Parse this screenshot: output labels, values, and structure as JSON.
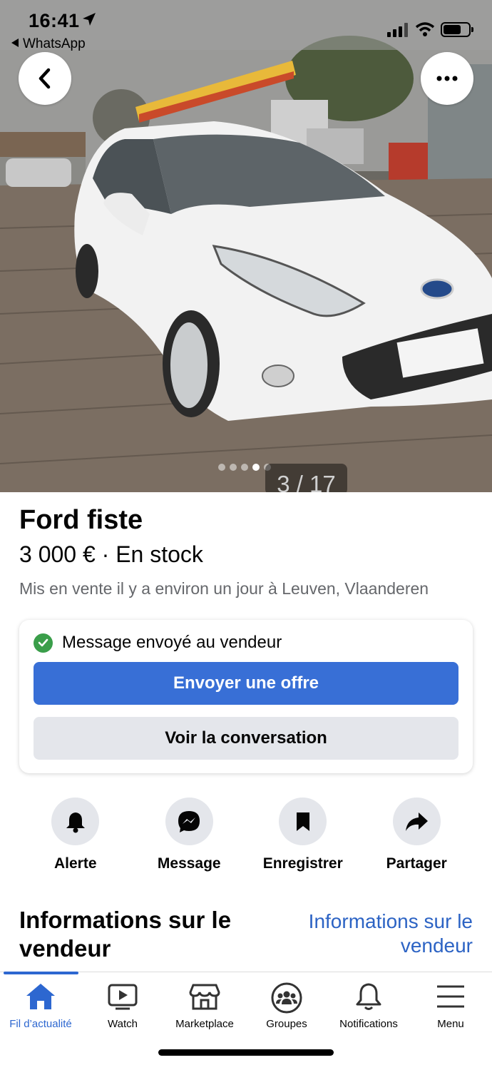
{
  "status_bar": {
    "time": "16:41",
    "back_app": "WhatsApp"
  },
  "photo": {
    "counter": "3 / 17",
    "dots_total": 5,
    "dots_active_index": 3
  },
  "listing": {
    "title": "Ford fiste",
    "price_line": "3 000 € · En stock",
    "listed_line": "Mis en vente il y a environ un jour à Leuven, Vlaanderen"
  },
  "message_card": {
    "sent_text": "Message envoyé au vendeur",
    "offer_button": "Envoyer une offre",
    "conversation_button": "Voir la conversation"
  },
  "actions": [
    {
      "label": "Alerte",
      "icon": "bell-icon"
    },
    {
      "label": "Message",
      "icon": "messenger-icon"
    },
    {
      "label": "Enregistrer",
      "icon": "bookmark-icon"
    },
    {
      "label": "Partager",
      "icon": "share-icon"
    }
  ],
  "seller": {
    "heading": "Informations sur le vendeur",
    "link": "Informations sur le vendeur"
  },
  "bottom_nav": [
    {
      "label": "Fil d’actualité",
      "icon": "home-icon",
      "active": true
    },
    {
      "label": "Watch",
      "icon": "watch-icon",
      "active": false
    },
    {
      "label": "Marketplace",
      "icon": "marketplace-icon",
      "active": false
    },
    {
      "label": "Groupes",
      "icon": "groups-icon",
      "active": false
    },
    {
      "label": "Notifications",
      "icon": "notifications-bell-icon",
      "active": false
    },
    {
      "label": "Menu",
      "icon": "hamburger-menu-icon",
      "active": false
    }
  ],
  "colors": {
    "accent_blue": "#386fd6",
    "link_blue": "#2c63c4",
    "success_green": "#3a9e4a",
    "secondary_button": "#e4e6eb",
    "muted_text": "#65676b"
  }
}
